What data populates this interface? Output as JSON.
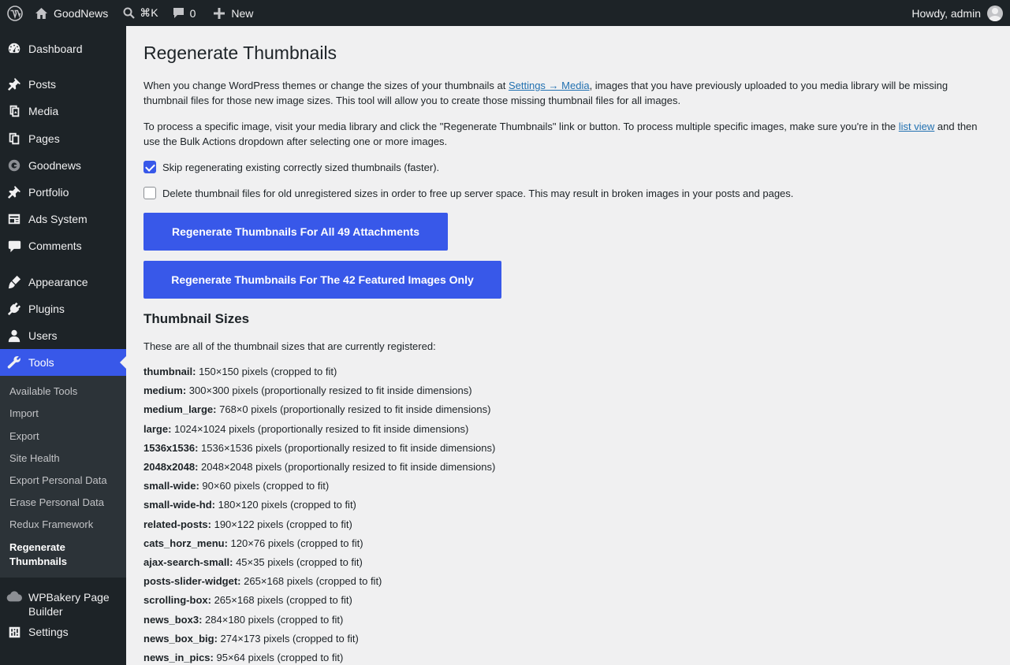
{
  "adminbar": {
    "site_name": "GoodNews",
    "search_shortcut": "⌘K",
    "comments_count": "0",
    "new_label": "New",
    "howdy": "Howdy, admin"
  },
  "sidebar": {
    "items": [
      {
        "label": "Dashboard",
        "icon": "dashboard-icon"
      },
      {
        "label": "Posts",
        "icon": "pin-icon"
      },
      {
        "label": "Media",
        "icon": "media-icon"
      },
      {
        "label": "Pages",
        "icon": "pages-icon"
      },
      {
        "label": "Goodnews",
        "icon": "goodnews-icon"
      },
      {
        "label": "Portfolio",
        "icon": "pin-icon"
      },
      {
        "label": "Ads System",
        "icon": "ads-icon"
      },
      {
        "label": "Comments",
        "icon": "comment-icon"
      },
      {
        "label": "Appearance",
        "icon": "brush-icon"
      },
      {
        "label": "Plugins",
        "icon": "plugin-icon"
      },
      {
        "label": "Users",
        "icon": "user-icon"
      },
      {
        "label": "Tools",
        "icon": "wrench-icon"
      },
      {
        "label": "WPBakery Page Builder",
        "icon": "cloud-icon"
      },
      {
        "label": "Settings",
        "icon": "settings-icon"
      }
    ],
    "submenu": [
      "Available Tools",
      "Import",
      "Export",
      "Site Health",
      "Export Personal Data",
      "Erase Personal Data",
      "Redux Framework",
      "Regenerate Thumbnails"
    ]
  },
  "main": {
    "title": "Regenerate Thumbnails",
    "intro_1a": "When you change WordPress themes or change the sizes of your thumbnails at ",
    "intro_1_link": "Settings → Media",
    "intro_1b": ", images that you have previously uploaded to you media library will be missing thumbnail files for those new image sizes. This tool will allow you to create those missing thumbnail files for all images.",
    "intro_2a": "To process a specific image, visit your media library and click the \"Regenerate Thumbnails\" link or button. To process multiple specific images, make sure you're in the ",
    "intro_2_link": "list view",
    "intro_2b": " and then use the Bulk Actions dropdown after selecting one or more images.",
    "checkbox_skip": "Skip regenerating existing correctly sized thumbnails (faster).",
    "checkbox_delete": "Delete thumbnail files for old unregistered sizes in order to free up server space. This may result in broken images in your posts and pages.",
    "button_all": "Regenerate Thumbnails For All 49 Attachments",
    "button_featured": "Regenerate Thumbnails For The 42 Featured Images Only",
    "sizes_title": "Thumbnail Sizes",
    "sizes_intro": "These are all of the thumbnail sizes that are currently registered:",
    "sizes": [
      {
        "name": "thumbnail:",
        "desc": "150×150 pixels (cropped to fit)"
      },
      {
        "name": "medium:",
        "desc": "300×300 pixels (proportionally resized to fit inside dimensions)"
      },
      {
        "name": "medium_large:",
        "desc": "768×0 pixels (proportionally resized to fit inside dimensions)"
      },
      {
        "name": "large:",
        "desc": "1024×1024 pixels (proportionally resized to fit inside dimensions)"
      },
      {
        "name": "1536x1536:",
        "desc": "1536×1536 pixels (proportionally resized to fit inside dimensions)"
      },
      {
        "name": "2048x2048:",
        "desc": "2048×2048 pixels (proportionally resized to fit inside dimensions)"
      },
      {
        "name": "small-wide:",
        "desc": "90×60 pixels (cropped to fit)"
      },
      {
        "name": "small-wide-hd:",
        "desc": "180×120 pixels (cropped to fit)"
      },
      {
        "name": "related-posts:",
        "desc": "190×122 pixels (cropped to fit)"
      },
      {
        "name": "cats_horz_menu:",
        "desc": "120×76 pixels (cropped to fit)"
      },
      {
        "name": "ajax-search-small:",
        "desc": "45×35 pixels (cropped to fit)"
      },
      {
        "name": "posts-slider-widget:",
        "desc": "265×168 pixels (cropped to fit)"
      },
      {
        "name": "scrolling-box:",
        "desc": "265×168 pixels (cropped to fit)"
      },
      {
        "name": "news_box3:",
        "desc": "284×180 pixels (cropped to fit)"
      },
      {
        "name": "news_box_big:",
        "desc": "274×173 pixels (cropped to fit)"
      },
      {
        "name": "news_in_pics:",
        "desc": "95×64 pixels (cropped to fit)"
      }
    ]
  },
  "colors": {
    "accent": "#3858e9",
    "adminbar_bg": "#1d2327",
    "page_bg": "#f0f0f1",
    "link": "#2271b1"
  }
}
